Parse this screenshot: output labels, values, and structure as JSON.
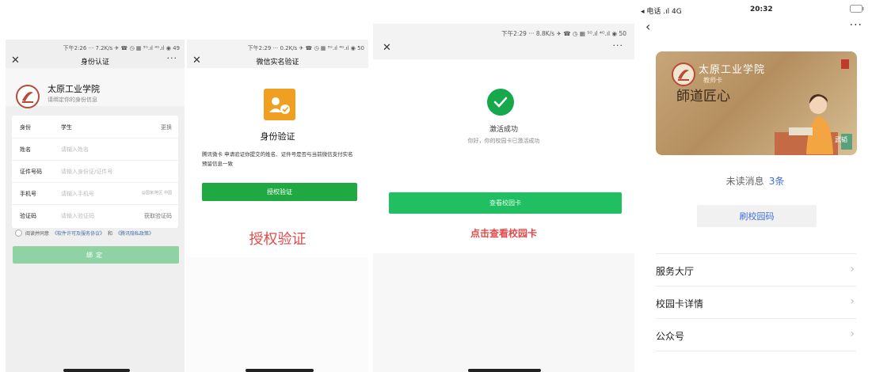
{
  "panel1": {
    "status": "下午2:26 ··· 7.2K/s ✈ ☎ ◷ ▦ ⁵ᴳ.ıl ⁴ᴳ.ıl ◉ 49",
    "title": "身份认证",
    "school": "太原工业学院",
    "hint": "请绑定你的身份信息",
    "rows": [
      {
        "label": "身份",
        "value": "学生",
        "action": "更换"
      },
      {
        "label": "姓名",
        "value": "请输入姓名",
        "action": ""
      },
      {
        "label": "证件号码",
        "value": "请输入身份证/证件号",
        "action": ""
      },
      {
        "label": "手机号",
        "value": "请输入手机号",
        "action": "@国家/地区 中国"
      },
      {
        "label": "验证码",
        "value": "请输入验证码",
        "action": "获取验证码"
      }
    ],
    "agree_prefix": "阅读并同意",
    "agree_link1": "《软件许可及服务协议》",
    "agree_mid": "和",
    "agree_link2": "《腾讯隐私政策》",
    "bind_button": "绑定"
  },
  "panel2": {
    "status": "下午2:29 ··· 0.2K/s ✈ ☎ ◷ ▦ ⁵ᴳ.ıl ⁴ᴳ.ıl ◉ 50",
    "title": "微信实名验证",
    "heading": "身份验证",
    "description": "腾讯微卡 申请验证你提交的姓名、证件号是否与当前微信支付实名预留信息一致",
    "button": "授权验证",
    "annotation": "授权验证"
  },
  "panel3": {
    "status": "下午2:29 ··· 8.8K/s ✈ ☎ ◷ ▦ ⁵ᴳ.ıl ⁴ᴳ.ıl ◉ 50",
    "success_title": "激活成功",
    "success_sub": "你好，你的校园卡已激活成功",
    "button": "查看校园卡",
    "annotation": "点击查看校园卡"
  },
  "panel4": {
    "carrier": "◂ 电话 .ıl 4G",
    "time": "20:32",
    "card": {
      "school": "太原工业学院",
      "type": "教师卡",
      "calligraphy": "師道匠心",
      "name": "武韬"
    },
    "unread_label": "未读消息",
    "unread_count": "3条",
    "scan_button": "刷校园码",
    "menu": [
      "服务大厅",
      "校园卡详情",
      "公众号"
    ]
  }
}
